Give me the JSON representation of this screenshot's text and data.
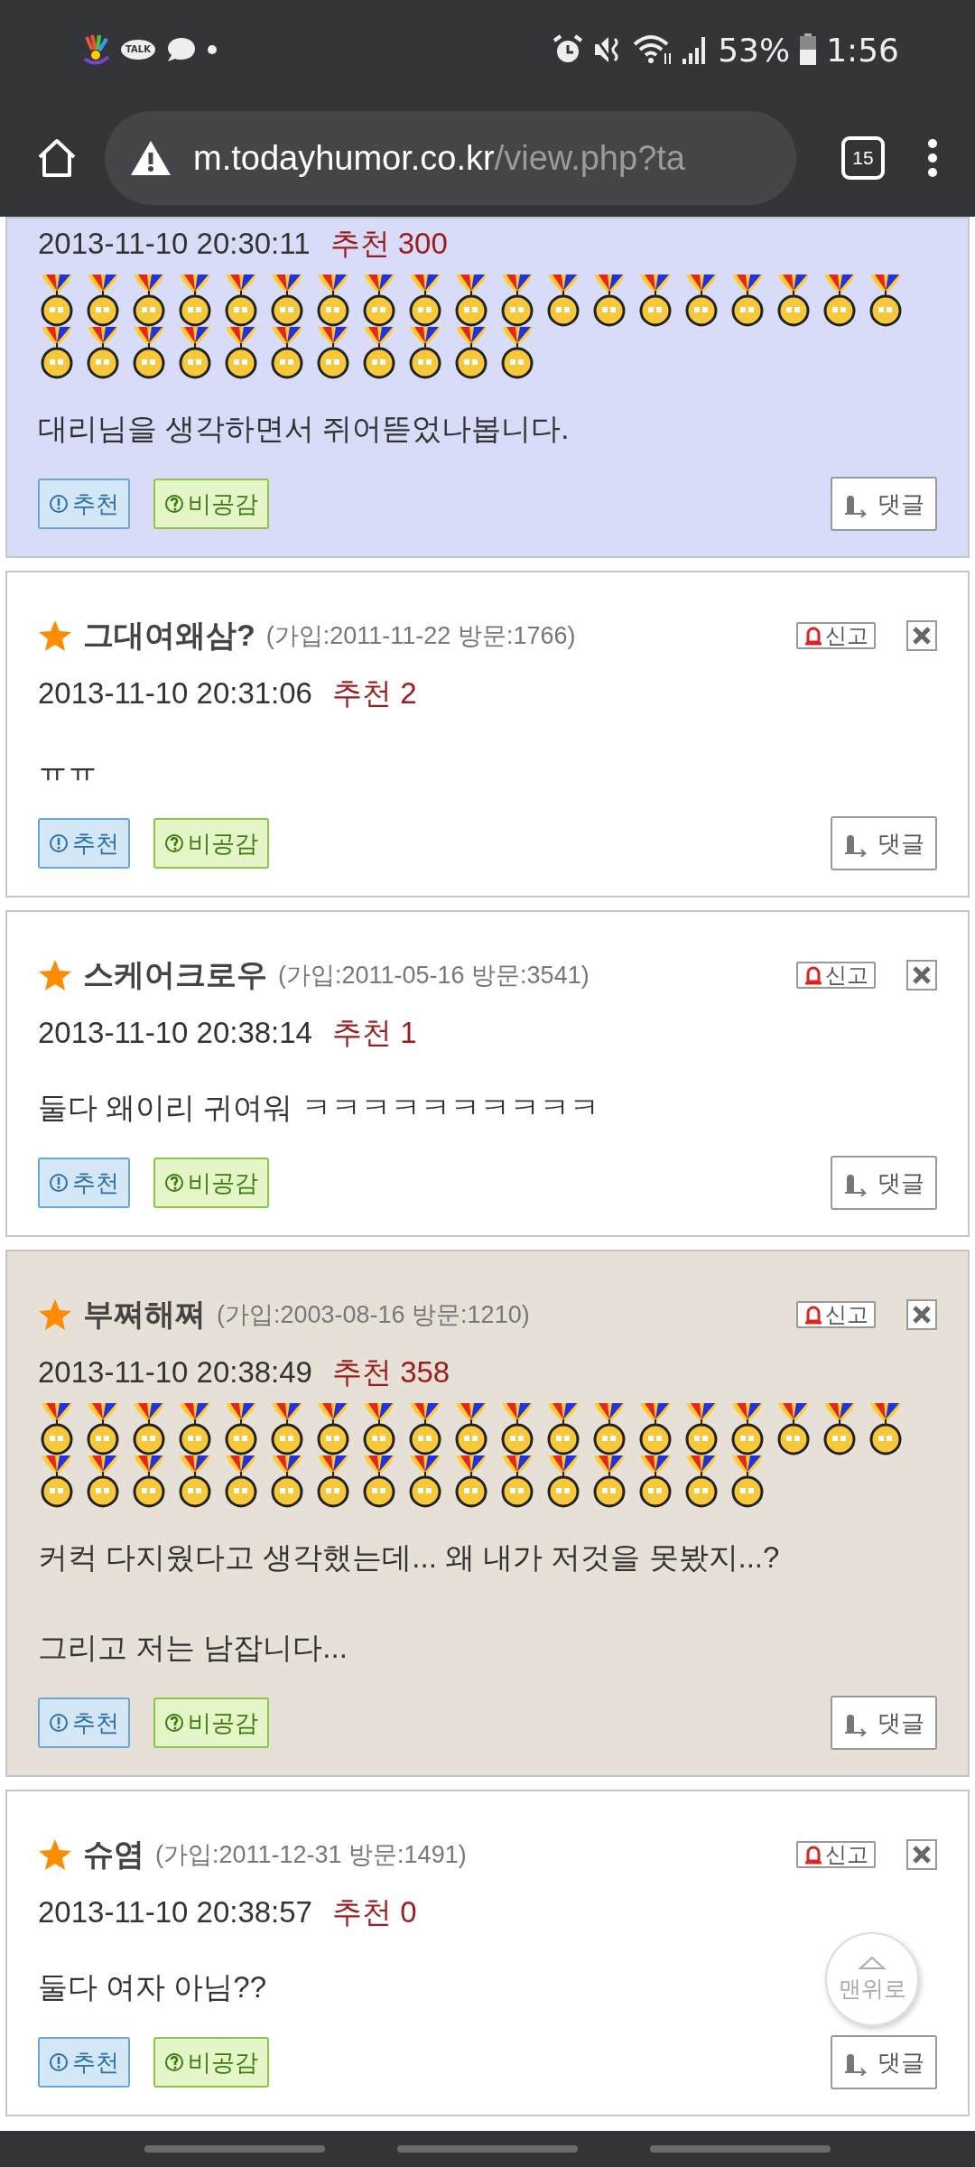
{
  "status_bar": {
    "talk_badge": "TALK",
    "battery": "53%",
    "time": "1:56"
  },
  "browser": {
    "domain": "m.todayhumor.co.kr",
    "path": "/view.php?ta",
    "tab_count": "15"
  },
  "comments": [
    {
      "color": "#d9dcf8",
      "date": "2013-11-10 20:30:11",
      "recommend": "추천 300",
      "medals": [
        {
          "kind": "gold"
        },
        {
          "kind": "gold"
        },
        {
          "kind": "gold"
        },
        {
          "kind": "gold"
        },
        {
          "kind": "gold"
        },
        {
          "kind": "gold"
        },
        {
          "kind": "gold"
        },
        {
          "kind": "gold"
        },
        {
          "kind": "gold"
        },
        {
          "kind": "gold"
        },
        {
          "kind": "gold"
        },
        {
          "kind": "gold"
        },
        {
          "kind": "gold"
        },
        {
          "kind": "gold"
        },
        {
          "kind": "gold"
        },
        {
          "kind": "gold"
        },
        {
          "kind": "gold"
        },
        {
          "kind": "gold"
        },
        {
          "kind": "gold"
        },
        {
          "kind": "gold"
        },
        {
          "kind": "gold"
        },
        {
          "kind": "gold"
        },
        {
          "kind": "gold"
        },
        {
          "kind": "gold"
        },
        {
          "kind": "gold"
        },
        {
          "kind": "gold"
        },
        {
          "kind": "gold"
        },
        {
          "kind": "gold"
        },
        {
          "kind": "gold"
        },
        {
          "kind": "gold"
        }
      ],
      "body": [
        "대리님을 생각하면서 쥐어뜯었나봅니다."
      ],
      "buttons": {
        "up": "추천",
        "down": "비공감",
        "reply": "댓글"
      }
    },
    {
      "color": "#ffffff",
      "author": "그대여왜삼?",
      "meta": "(가입:2011-11-22 방문:1766)",
      "report": "신고",
      "date": "2013-11-10 20:31:06",
      "recommend": "추천 2",
      "body": [
        "ㅠㅠ"
      ],
      "buttons": {
        "up": "추천",
        "down": "비공감",
        "reply": "댓글"
      }
    },
    {
      "color": "#ffffff",
      "author": "스케어크로우",
      "meta": "(가입:2011-05-16 방문:3541)",
      "report": "신고",
      "date": "2013-11-10 20:38:14",
      "recommend": "추천 1",
      "body": [
        "둘다 왜이리 귀여워 ㅋㅋㅋㅋㅋㅋㅋㅋㅋㅋ"
      ],
      "buttons": {
        "up": "추천",
        "down": "비공감",
        "reply": "댓글"
      }
    },
    {
      "color": "#e6e0d6",
      "author": "부쪄해쪄",
      "meta": "(가입:2003-08-16 방문:1210)",
      "report": "신고",
      "date": "2013-11-10 20:38:49",
      "recommend": "추천 358",
      "medals": [
        {
          "kind": "gold"
        },
        {
          "kind": "gold"
        },
        {
          "kind": "gold"
        },
        {
          "kind": "gold"
        },
        {
          "kind": "gold"
        },
        {
          "kind": "gold"
        },
        {
          "kind": "gold"
        },
        {
          "kind": "gold"
        },
        {
          "kind": "gold"
        },
        {
          "kind": "gold"
        },
        {
          "kind": "gold"
        },
        {
          "kind": "gold"
        },
        {
          "kind": "gold"
        },
        {
          "kind": "gold"
        },
        {
          "kind": "gold"
        },
        {
          "kind": "gold"
        },
        {
          "kind": "gold"
        },
        {
          "kind": "gold"
        },
        {
          "kind": "gold"
        },
        {
          "kind": "gold"
        },
        {
          "kind": "gold"
        },
        {
          "kind": "gold"
        },
        {
          "kind": "gold"
        },
        {
          "kind": "gold"
        },
        {
          "kind": "gold"
        },
        {
          "kind": "gold"
        },
        {
          "kind": "gold"
        },
        {
          "kind": "gold"
        },
        {
          "kind": "gold"
        },
        {
          "kind": "gold"
        },
        {
          "kind": "gold"
        },
        {
          "kind": "gold"
        },
        {
          "kind": "gold"
        },
        {
          "kind": "gold"
        },
        {
          "kind": "gold"
        }
      ],
      "body": [
        "커컥 다지웠다고 생각했는데... 왜 내가 저것을 못봤지...?",
        "그리고 저는 남잡니다..."
      ],
      "buttons": {
        "up": "추천",
        "down": "비공감",
        "reply": "댓글"
      }
    },
    {
      "color": "#ffffff",
      "author": "슈염",
      "meta": "(가입:2011-12-31 방문:1491)",
      "report": "신고",
      "date": "2013-11-10 20:38:57",
      "recommend": "추천 0",
      "body": [
        "둘다 여자 아님??"
      ],
      "buttons": {
        "up": "추천",
        "down": "비공감",
        "reply": "댓글"
      }
    }
  ],
  "top_button": {
    "label": "맨위로"
  }
}
